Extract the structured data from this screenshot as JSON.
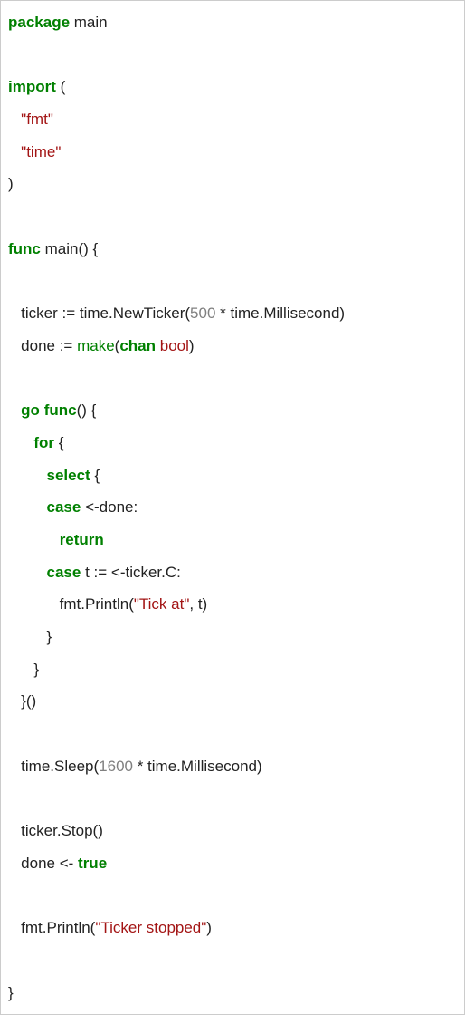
{
  "code": {
    "l1a": "package",
    "l1b": " main",
    "l3a": "import",
    "l3b": " (",
    "l4a": "   ",
    "l4b": "\"fmt\"",
    "l5a": "   ",
    "l5b": "\"time\"",
    "l6": ")",
    "l8a": "func",
    "l8b": " main() {",
    "l10a": "   ticker := time.NewTicker(",
    "l10b": "500",
    "l10c": " * time.Millisecond)",
    "l11a": "   done := ",
    "l11b": "make",
    "l11c": "(",
    "l11d": "chan",
    "l11e": " ",
    "l11f": "bool",
    "l11g": ")",
    "l13a": "   ",
    "l13b": "go",
    "l13c": " ",
    "l13d": "func",
    "l13e": "() {",
    "l14a": "      ",
    "l14b": "for",
    "l14c": " {",
    "l15a": "         ",
    "l15b": "select",
    "l15c": " {",
    "l16a": "         ",
    "l16b": "case",
    "l16c": " <-done:",
    "l17a": "            ",
    "l17b": "return",
    "l18a": "         ",
    "l18b": "case",
    "l18c": " t := <-ticker.C:",
    "l19a": "            fmt.Println(",
    "l19b": "\"Tick at\"",
    "l19c": ", t)",
    "l20": "         }",
    "l21": "      }",
    "l22": "   }()",
    "l24a": "   time.Sleep(",
    "l24b": "1600",
    "l24c": " * time.Millisecond)",
    "l26": "   ticker.Stop()",
    "l27a": "   done <- ",
    "l27b": "true",
    "l29a": "   fmt.Println(",
    "l29b": "\"Ticker stopped\"",
    "l29c": ")",
    "l31": "}"
  }
}
